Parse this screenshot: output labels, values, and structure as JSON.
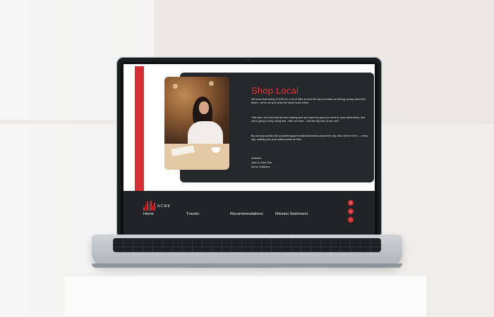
{
  "website": {
    "hero": {
      "title": "Shop Local",
      "paragraphs": [
        "We know that during COVID-19, a lot of folks around the city and state are feeling uneasy about the future - we're not sure what the future holds either.",
        "That said, we know that we love making sure you have the gear you need for your adventures, and we're going to keep doing that - with our team - until the city tells us we can't.",
        "But as long as folks like yourself support small businesses around the city, then we'll be here — every day, making sure your orders arrive on time."
      ],
      "signature_line1": "Jane & John Doe",
      "signature_line2": "Acme Outdoors"
    },
    "footer": {
      "logo_text": "ACME",
      "nav": [
        "Home",
        "Travels",
        "Recommendations",
        "Mission Statement"
      ],
      "social_icons": [
        "instagram-icon",
        "pinterest-icon",
        "twitter-icon"
      ]
    },
    "colors": {
      "accent": "#d42f35",
      "card": "#26272b",
      "footer": "#222327"
    }
  }
}
